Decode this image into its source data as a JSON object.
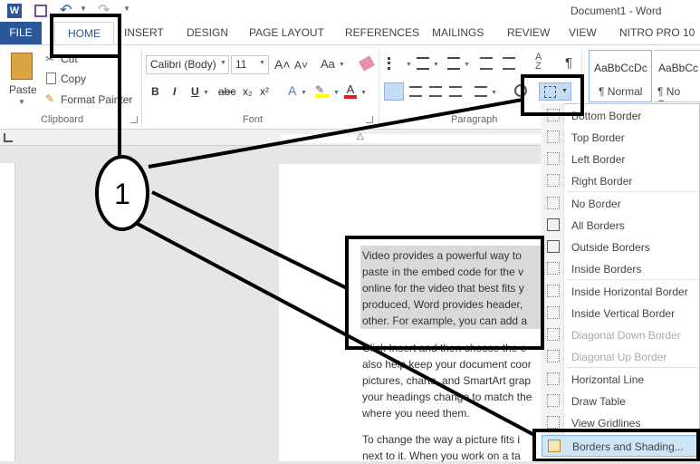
{
  "window": {
    "title": "Document1 - Word"
  },
  "quick_access": {
    "save_icon": "save-icon",
    "undo_icon": "undo-icon",
    "redo_icon": "redo-icon"
  },
  "tabs": [
    "FILE",
    "HOME",
    "INSERT",
    "DESIGN",
    "PAGE LAYOUT",
    "REFERENCES",
    "MAILINGS",
    "REVIEW",
    "VIEW",
    "NITRO PRO 10"
  ],
  "clipboard": {
    "paste": "Paste",
    "cut": "Cut",
    "copy": "Copy",
    "format_painter": "Format Painter",
    "label": "Clipboard"
  },
  "font": {
    "name": "Calibri (Body)",
    "size": "11",
    "label": "Font",
    "bold": "B",
    "italic": "I",
    "underline": "U",
    "strike": "abc",
    "subscript": "x₂",
    "superscript": "x²",
    "grow": "A˄",
    "shrink": "A˅",
    "case": "Aa"
  },
  "paragraph": {
    "label": "Paragraph",
    "pilcrow": "¶"
  },
  "styles": [
    {
      "preview": "AaBbCcDc",
      "name": "¶ Normal"
    },
    {
      "preview": "AaBbCc",
      "name": "¶ No Spa"
    }
  ],
  "document": {
    "lines": [
      "Video provides a powerful way to",
      "paste in the embed code for the v",
      "online for the video that best fits y",
      "produced, Word provides header,",
      "other. For example, you can add a",
      "Click Insert and then choose the e",
      "also help keep your document coor",
      "pictures, charts, and SmartArt grap",
      "your headings change to match the",
      "where you need them.",
      "To change the way a picture fits i",
      "next to it. When you work on a ta"
    ]
  },
  "border_menu": {
    "items": [
      {
        "label": "Bottom Border",
        "enabled": true
      },
      {
        "label": "Top Border",
        "enabled": true
      },
      {
        "label": "Left Border",
        "enabled": true
      },
      {
        "label": "Right Border",
        "enabled": true
      },
      {
        "label": "No Border",
        "enabled": true
      },
      {
        "label": "All Borders",
        "enabled": true
      },
      {
        "label": "Outside Borders",
        "enabled": true
      },
      {
        "label": "Inside Borders",
        "enabled": true
      },
      {
        "label": "Inside Horizontal Border",
        "enabled": true
      },
      {
        "label": "Inside Vertical Border",
        "enabled": true
      },
      {
        "label": "Diagonal Down Border",
        "enabled": false
      },
      {
        "label": "Diagonal Up Border",
        "enabled": false
      },
      {
        "label": "Horizontal Line",
        "enabled": true
      },
      {
        "label": "Draw Table",
        "enabled": true
      },
      {
        "label": "View Gridlines",
        "enabled": true
      },
      {
        "label": "Borders and Shading...",
        "enabled": true
      }
    ]
  },
  "annotation": {
    "number": "1"
  },
  "colors": {
    "accent": "#2b579a",
    "annotation": "#000000",
    "highlight": "#d9d9d9",
    "menu_hover": "#cde6f7"
  }
}
